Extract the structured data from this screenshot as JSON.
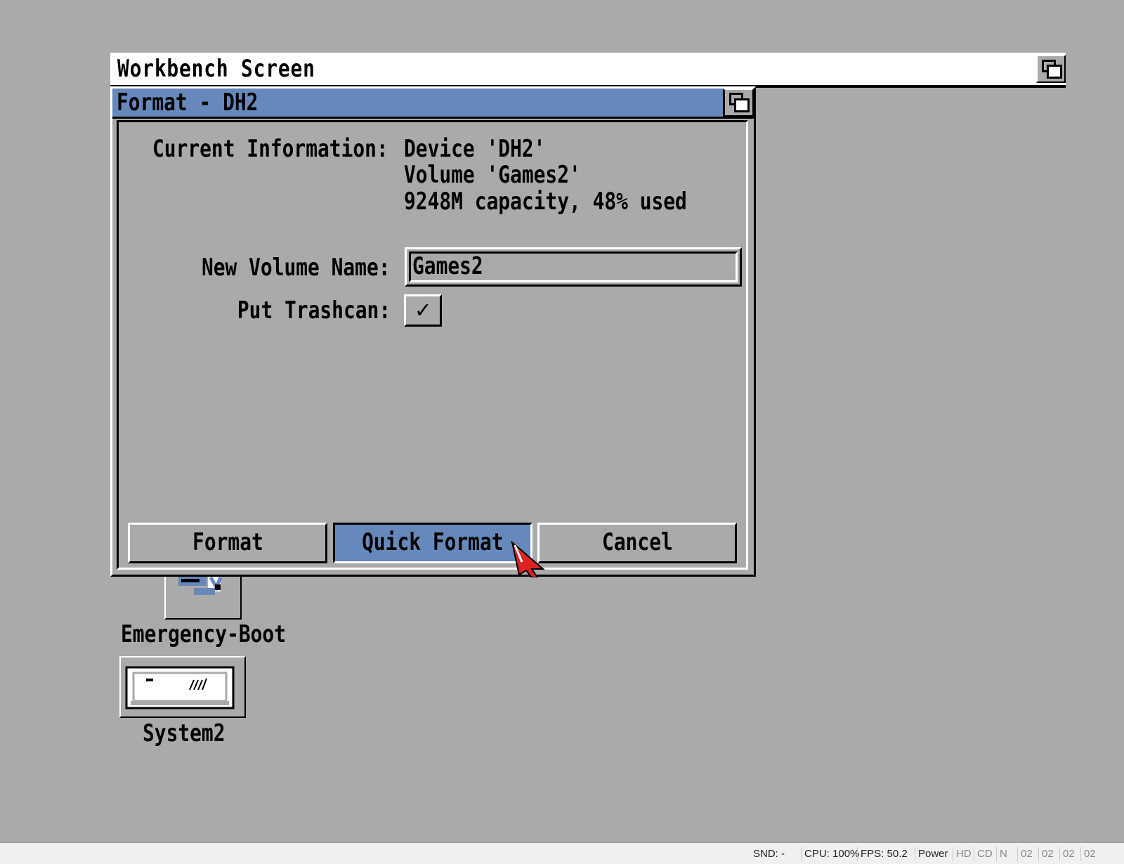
{
  "screen": {
    "title": "Workbench Screen"
  },
  "window": {
    "title": "Format - DH2",
    "info_label": "Current Information:",
    "info_lines": [
      "Device 'DH2'",
      "Volume 'Games2'",
      "9248M capacity, 48% used"
    ],
    "volume_label": "New Volume Name:",
    "volume_value": "Games2",
    "trashcan_label": "Put Trashcan:",
    "trashcan_mark": "✓",
    "trashcan_checked": true,
    "buttons": {
      "format": "Format",
      "quick_format": "Quick Format",
      "cancel": "Cancel"
    }
  },
  "desktop_icons": [
    {
      "label": "Emergency-Boot"
    },
    {
      "label": "System2"
    }
  ],
  "status_bar": {
    "snd": "SND: -",
    "cpu": "CPU: 100%",
    "fps": "FPS: 50.2",
    "power": "Power",
    "hd": "HD",
    "cd": "CD",
    "n": "N",
    "drives": [
      "02",
      "02",
      "02",
      "02"
    ]
  },
  "colors": {
    "desktop": "#aaaaaa",
    "accent": "#6688bb",
    "cursor": "#dd2222"
  }
}
